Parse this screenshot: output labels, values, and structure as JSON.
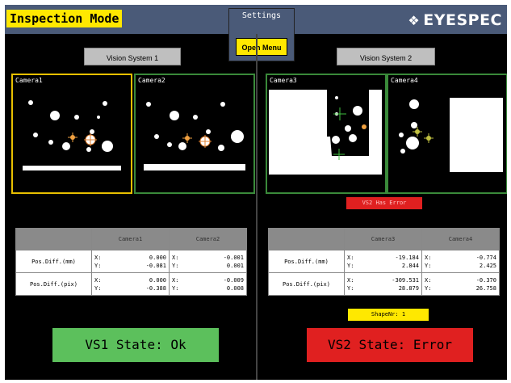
{
  "header": {
    "title": "Inspection Mode",
    "settings_label": "Settings",
    "open_menu_label": "Open Menu",
    "brand": "EYESPEC",
    "brand_icon": "diamond-logo-icon"
  },
  "vs1": {
    "button_label": "Vision System 1",
    "cameras": [
      {
        "label": "Camera1",
        "selected": true
      },
      {
        "label": "Camera2",
        "selected": false
      }
    ],
    "table": {
      "col1": "Camera1",
      "col2": "Camera2",
      "rows": [
        {
          "label": "Pos.Diff.(mm)",
          "c1": {
            "x": "0.000",
            "y": "-0.081"
          },
          "c2": {
            "x": "-0.001",
            "y": "0.001"
          }
        },
        {
          "label": "Pos.Diff.(pix)",
          "c1": {
            "x": "0.000",
            "y": "-0.388"
          },
          "c2": {
            "x": "-0.009",
            "y": "0.008"
          }
        }
      ]
    },
    "state": "VS1 State: Ok"
  },
  "vs2": {
    "button_label": "Vision System 2",
    "cameras": [
      {
        "label": "Camera3",
        "selected": false
      },
      {
        "label": "Camera4",
        "selected": false
      }
    ],
    "error_text": "VS2 Has Error",
    "table": {
      "col1": "Camera3",
      "col2": "Camera4",
      "rows": [
        {
          "label": "Pos.Diff.(mm)",
          "c1": {
            "x": "-19.184",
            "y": "2.844"
          },
          "c2": {
            "x": "-0.774",
            "y": "2.425"
          }
        },
        {
          "label": "Pos.Diff.(pix)",
          "c1": {
            "x": "-309.531",
            "y": "28.879"
          },
          "c2": {
            "x": "-0.370",
            "y": "26.758"
          }
        }
      ]
    },
    "shape_text": "ShapeNr:   1",
    "state": "VS2 State: Error"
  },
  "colors": {
    "title_bg": "#ffe800",
    "titlebar": "#4a5a78",
    "ok": "#5cc05c",
    "error": "#e02020",
    "cam_selected": "#e8c000",
    "cam_border": "#3a8a3a"
  }
}
